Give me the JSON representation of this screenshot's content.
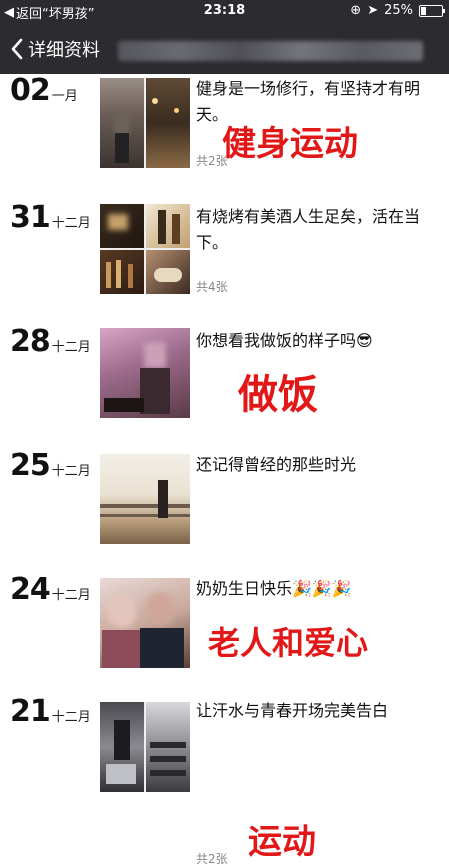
{
  "status_bar": {
    "back_app": "返回“坏男孩”",
    "time": "23:18",
    "battery": "25%",
    "battery_level": 0.25
  },
  "nav": {
    "title": "详细资料"
  },
  "entries": [
    {
      "day": "02",
      "month": "一月",
      "text": "健身是一场修行，有坚持才有明天。",
      "count": "共2张",
      "overlay": "健身运动"
    },
    {
      "day": "31",
      "month": "十二月",
      "text": "有烧烤有美酒人生足矣，活在当下。",
      "count": "共4张",
      "overlay": ""
    },
    {
      "day": "28",
      "month": "十二月",
      "text": "你想看我做饭的样子吗😎",
      "count": "",
      "overlay": "做饭"
    },
    {
      "day": "25",
      "month": "十二月",
      "text": "还记得曾经的那些时光",
      "count": "",
      "overlay": ""
    },
    {
      "day": "24",
      "month": "十二月",
      "text": "奶奶生日快乐🎉🎉🎉",
      "count": "",
      "overlay": "老人和爱心"
    },
    {
      "day": "21",
      "month": "十二月",
      "text": "让汗水与青春开场完美告白",
      "count": "共2张",
      "overlay": "运动"
    }
  ]
}
